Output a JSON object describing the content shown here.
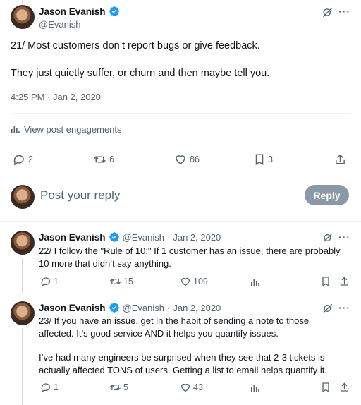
{
  "main_post": {
    "author_name": "Jason Evanish",
    "author_handle": "@Evanish",
    "text_line1": "21/ Most customers don’t report bugs or give feedback.",
    "text_line2": "They just quietly suffer, or churn and then maybe tell you.",
    "timestamp": "4:25 PM · Jan 2, 2020",
    "engagements_label": "View post engagements",
    "replies": "2",
    "reposts": "6",
    "likes": "86",
    "bookmarks": "3"
  },
  "reply_box": {
    "placeholder": "Post your reply",
    "button_label": "Reply"
  },
  "replies": [
    {
      "author_name": "Jason Evanish",
      "author_handle": "@Evanish",
      "date": "Jan 2, 2020",
      "text": "22/ I follow the \"Rule of 10:\" If 1 customer has an issue, there are probably 10 more that didn’t say anything.",
      "replies": "1",
      "reposts": "15",
      "likes": "109"
    },
    {
      "author_name": "Jason Evanish",
      "author_handle": "@Evanish",
      "date": "Jan 2, 2020",
      "text_p1": "23/ If you have an issue, get in the habit of sending a note to those affected. It’s good service AND it helps you quantify issues.",
      "text_p2": "I’ve had many engineers be surprised when they see that 2-3 tickets is actually affected TONS of users. Getting a list to email helps quantify it.",
      "replies": "1",
      "reposts": "5",
      "likes": "43"
    }
  ],
  "colors": {
    "verified": "#1d9bf0",
    "muted_text": "#536471",
    "reply_button_disabled": "#8b98a5"
  }
}
